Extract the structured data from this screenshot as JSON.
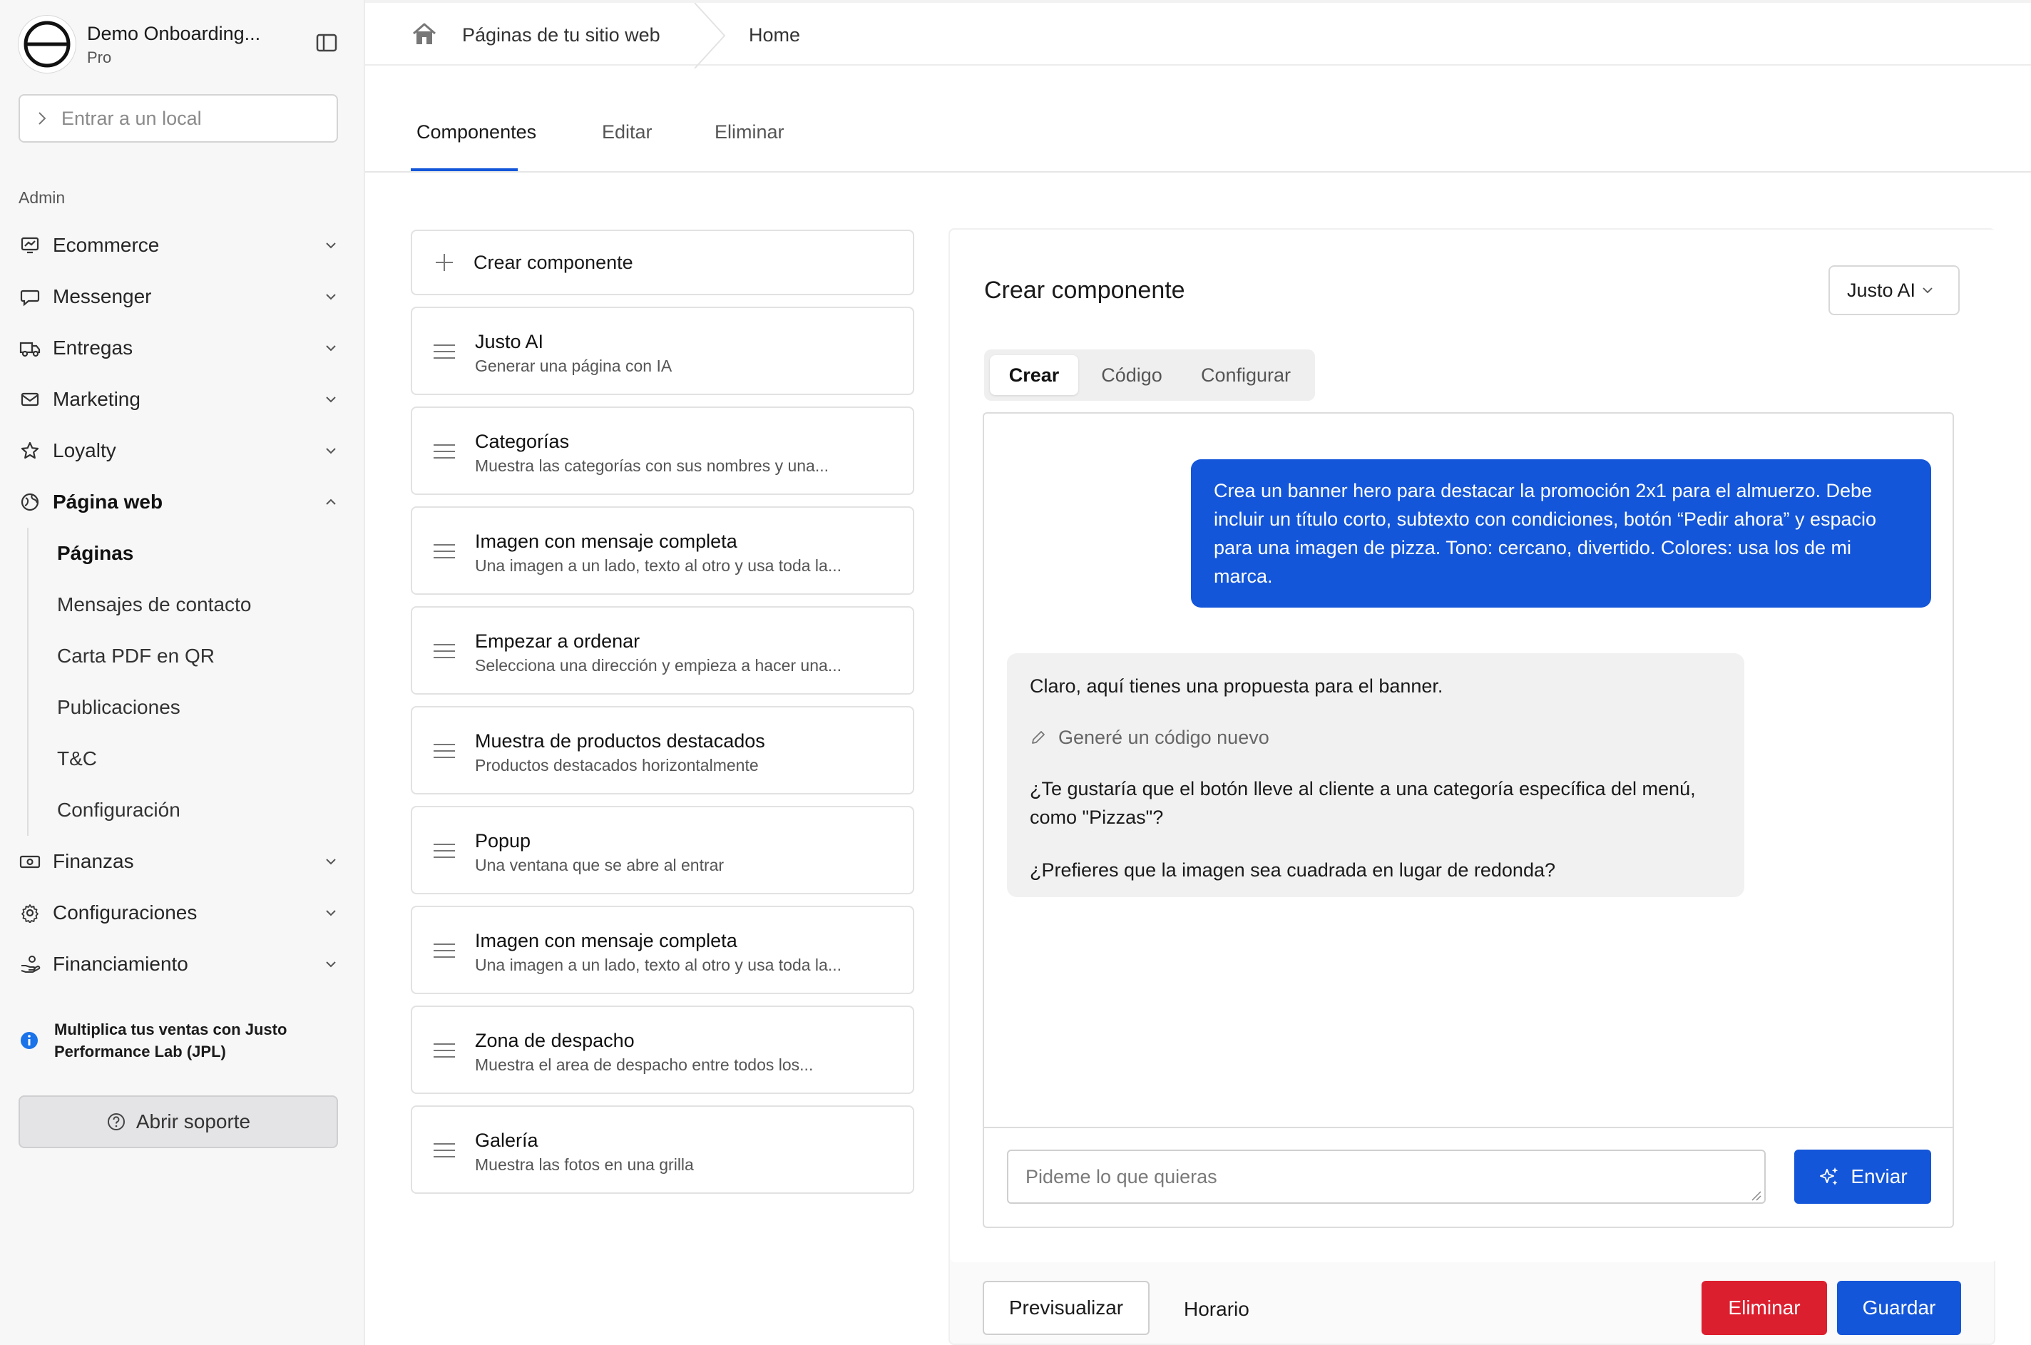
{
  "brand": {
    "name": "Demo Onboarding...",
    "plan": "Pro"
  },
  "sidebar": {
    "enter_local_placeholder": "Entrar a un local",
    "section_label": "Admin",
    "items": [
      {
        "label": "Ecommerce",
        "icon": "chart-icon"
      },
      {
        "label": "Messenger",
        "icon": "chat-icon"
      },
      {
        "label": "Entregas",
        "icon": "truck-icon"
      },
      {
        "label": "Marketing",
        "icon": "mail-icon"
      },
      {
        "label": "Loyalty",
        "icon": "star-icon"
      },
      {
        "label": "Página web",
        "icon": "globe-icon"
      },
      {
        "label": "Finanzas",
        "icon": "money-icon"
      },
      {
        "label": "Configuraciones",
        "icon": "gear-icon"
      },
      {
        "label": "Financiamiento",
        "icon": "hand-coins-icon"
      }
    ],
    "subitems": [
      "Páginas",
      "Mensajes de contacto",
      "Carta PDF en QR",
      "Publicaciones",
      "T&C",
      "Configuración"
    ],
    "promo": "Multiplica tus ventas con Justo Performance Lab (JPL)",
    "support_label": "Abrir soporte"
  },
  "breadcrumb": {
    "item1": "Páginas de tu sitio web",
    "item2": "Home"
  },
  "tabs": [
    "Componentes",
    "Editar",
    "Eliminar"
  ],
  "components": {
    "create_label": "Crear componente",
    "cards": [
      {
        "title": "Justo AI",
        "desc": "Generar una página con IA"
      },
      {
        "title": "Categorías",
        "desc": "Muestra las categorías con sus nombres y una..."
      },
      {
        "title": "Imagen con mensaje completa",
        "desc": "Una imagen a un lado, texto al otro y usa toda la..."
      },
      {
        "title": "Empezar a ordenar",
        "desc": "Selecciona una dirección y empieza a hacer una..."
      },
      {
        "title": "Muestra de productos destacados",
        "desc": "Productos destacados horizontalmente"
      },
      {
        "title": "Popup",
        "desc": "Una ventana que se abre al entrar"
      },
      {
        "title": "Imagen con mensaje completa",
        "desc": "Una imagen a un lado, texto al otro y usa toda la..."
      },
      {
        "title": "Zona de despacho",
        "desc": "Muestra el area de despacho entre todos los..."
      },
      {
        "title": "Galería",
        "desc": "Muestra las fotos en una grilla"
      }
    ]
  },
  "panel": {
    "title": "Crear componente",
    "select_value": "Justo AI",
    "segments": [
      "Crear",
      "Código",
      "Configurar"
    ],
    "user_message": "Crea un banner hero para destacar la promoción 2x1 para el almuerzo. Debe incluir un título corto, subtexto con condiciones, botón “Pedir ahora” y espacio para una imagen de pizza. Tono: cercano, divertido. Colores: usa los de mi marca.",
    "bot": {
      "intro": "Claro, aquí tienes una propuesta para el banner.",
      "generated": "Generé un código nuevo",
      "q1": "¿Te gustaría que el botón lleve al cliente a una categoría específica del menú, como \"Pizzas\"?",
      "q2": "¿Prefieres que la imagen sea cuadrada en lugar de redonda?"
    },
    "input_placeholder": "Pideme lo que quieras",
    "send_label": "Enviar",
    "preview_label": "Previsualizar",
    "horario_label": "Horario",
    "delete_label": "Eliminar",
    "save_label": "Guardar"
  },
  "colors": {
    "accent": "#1456d9",
    "danger": "#dc1f2e",
    "info": "#1a73e8"
  }
}
